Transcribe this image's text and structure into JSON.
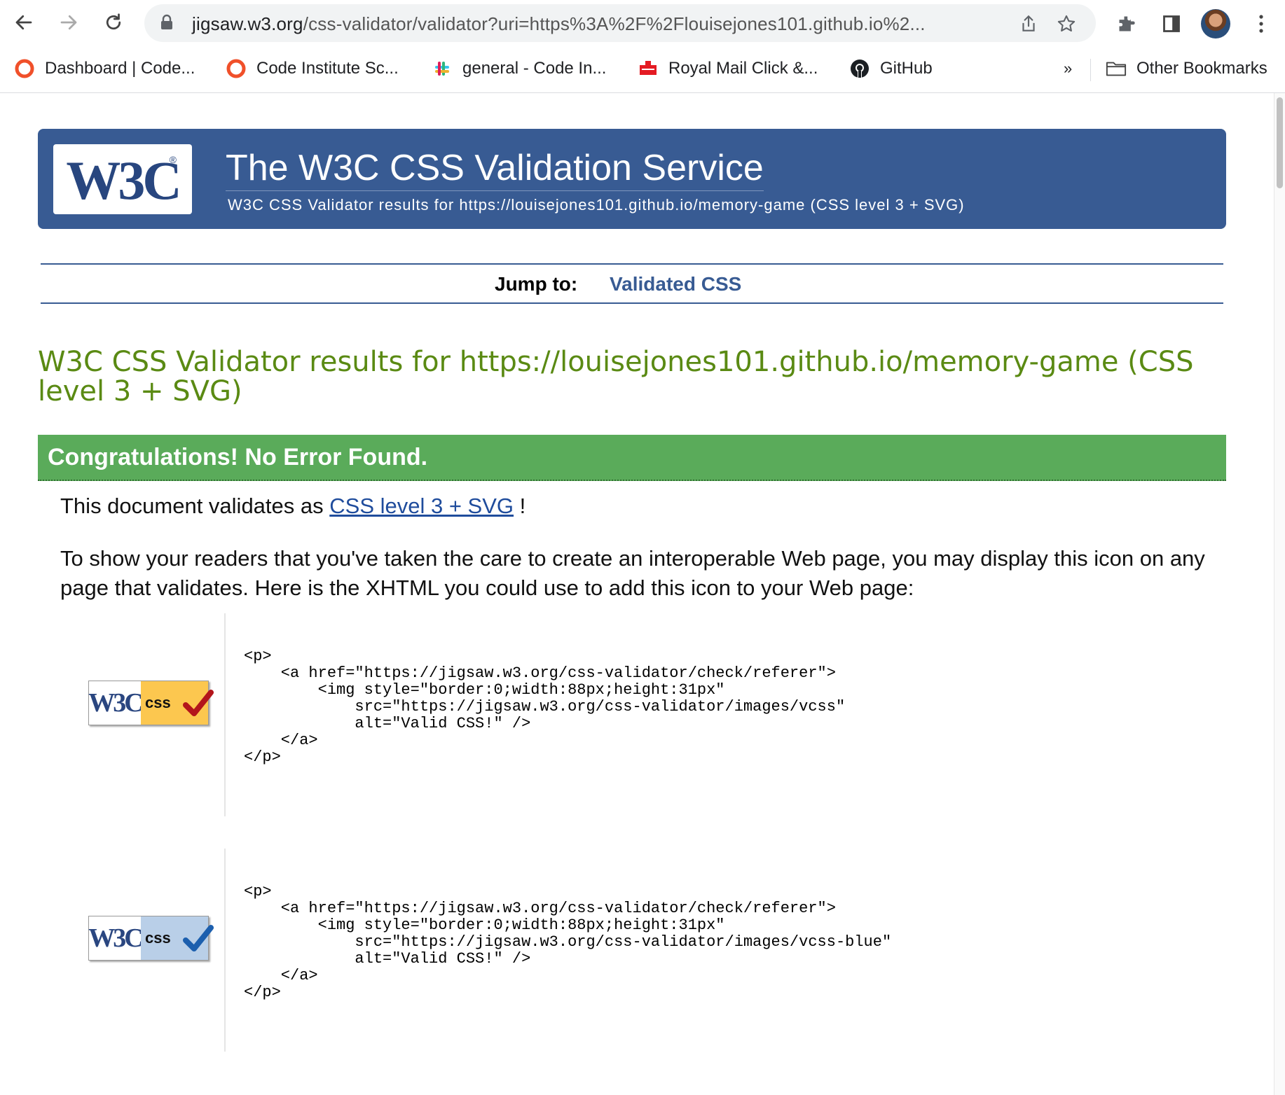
{
  "browser": {
    "url_host": "jigsaw.w3.org",
    "url_path": "/css-validator/validator?uri=https%3A%2F%2Flouisejones101.github.io%2...",
    "bookmarks": [
      {
        "label": "Dashboard | Code...",
        "icon": "code-institute-icon"
      },
      {
        "label": "Code Institute Sc...",
        "icon": "code-institute-icon"
      },
      {
        "label": "general - Code In...",
        "icon": "slack-icon"
      },
      {
        "label": "Royal Mail Click &...",
        "icon": "royal-mail-icon"
      },
      {
        "label": "GitHub",
        "icon": "github-icon"
      }
    ],
    "overflow_label": "»",
    "other_bookmarks": "Other Bookmarks"
  },
  "banner": {
    "logo": "W3C",
    "title": "The W3C CSS Validation Service",
    "subtitle": "W3C CSS Validator results for https://louisejones101.github.io/memory-game (CSS level 3 + SVG)"
  },
  "jump": {
    "label": "Jump to:",
    "link": "Validated CSS"
  },
  "results": {
    "title": "W3C CSS Validator results for https://louisejones101.github.io/memory-game (CSS level 3 + SVG)",
    "congrats": "Congratulations! No Error Found.",
    "validates_prefix": "This document validates as",
    "validates_link": "CSS level 3 + SVG",
    "validates_suffix": "!",
    "icon_text": "To show your readers that you've taken the care to create an interoperable Web page, you may display this icon on any page that validates. Here is the XHTML you could use to add this icon to your Web page:"
  },
  "examples": [
    {
      "badge_logo": "W3C",
      "badge_text": "css",
      "badge_color": "#fcc74f",
      "check_color": "#b3151b",
      "code": "<p>\n    <a href=\"https://jigsaw.w3.org/css-validator/check/referer\">\n        <img style=\"border:0;width:88px;height:31px\"\n            src=\"https://jigsaw.w3.org/css-validator/images/vcss\"\n            alt=\"Valid CSS!\" />\n    </a>\n</p>"
    },
    {
      "badge_logo": "W3C",
      "badge_text": "css",
      "badge_color": "#b9cfe8",
      "check_color": "#1c5fae",
      "code": "<p>\n    <a href=\"https://jigsaw.w3.org/css-validator/check/referer\">\n        <img style=\"border:0;width:88px;height:31px\"\n            src=\"https://jigsaw.w3.org/css-validator/images/vcss-blue\"\n            alt=\"Valid CSS!\" />\n    </a>\n</p>"
    }
  ]
}
